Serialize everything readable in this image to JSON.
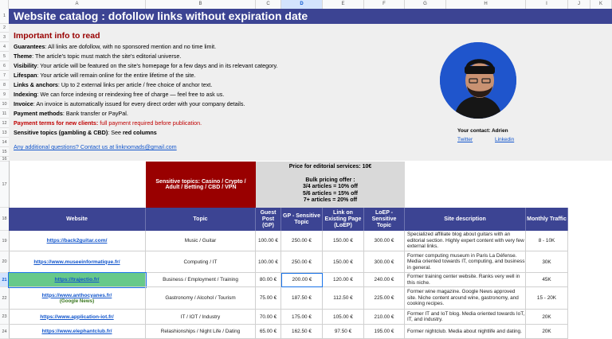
{
  "columns": [
    "A",
    "B",
    "C",
    "D",
    "E",
    "F",
    "G",
    "H",
    "I",
    "J",
    "K"
  ],
  "rows": [
    "1",
    "2",
    "3",
    "4",
    "5",
    "6",
    "7",
    "8",
    "9",
    "10",
    "11",
    "12",
    "13",
    "14",
    "15",
    "16",
    "17",
    "18",
    "19",
    "20",
    "21",
    "22",
    "23",
    "24"
  ],
  "title": "Website catalog : dofollow links without expiration date",
  "info": {
    "heading": "Important info to read",
    "lines": [
      {
        "label": "Guarantees",
        "text": ": All links are dofollow, with no sponsored mention and no time limit."
      },
      {
        "label": "Theme",
        "text": ": The article's topic must match the site's editorial universe."
      },
      {
        "label": "Visibility",
        "text": ": Your article will be featured on the site's homepage for a few days and in its relevant category."
      },
      {
        "label": "Lifespan",
        "text": ": Your article will remain online for the entire lifetime of the site."
      },
      {
        "label": "Links & anchors",
        "text": ": Up to 2 external links per article / free choice of anchor text."
      },
      {
        "label": "Indexing",
        "text": ": We can force indexing or reindexing free of charge — feel free to ask us."
      },
      {
        "label": "Invoice",
        "text": ": An invoice is automatically issued for every direct order with your company details."
      },
      {
        "label": "Payment methods",
        "text": ": Bank transfer or PayPal."
      }
    ],
    "payment_terms_label": "Payment terms for new clients:",
    "payment_terms_text": " full payment required before publication.",
    "sensitive_label": "Sensitive topics (gambling & CBD)",
    "sensitive_text": ": See ",
    "sensitive_bold": "red columns",
    "question_label": "Any additional questions?",
    "question_text": " Contact us at  linknomads@gmail.com"
  },
  "contact": {
    "label": "Your contact: Adrien",
    "twitter": "Twitter",
    "linkedin": "Linkedin"
  },
  "pricing": {
    "sensitive_header": "Sensitive topics: Casino / Crypto / Adult / Betting / CBD / VPN",
    "price_line": "Price for editorial services: 10€",
    "bulk_title": "Bulk pricing offer :",
    "bulk_1": "3/4 articles = 10% off",
    "bulk_2": "5/6 articles = 15% off",
    "bulk_3": "7+ articles = 20% off"
  },
  "headers": {
    "website": "Website",
    "topic": "Topic",
    "gp": "Guest Post (GP)",
    "gps": "GP - Sensitive Topic",
    "loep": "Link on Existing Page (LoEP)",
    "loeps": "LoEP - Sensitive Topic",
    "desc": "Site description",
    "traffic": "Monthly Traffic"
  },
  "table": [
    {
      "site": "https://back2guitar.com/",
      "tag": "",
      "topic": "Music / Guitar",
      "gp": "100.00 €",
      "gps": "250.00 €",
      "loep": "150.00 €",
      "loeps": "300.00 €",
      "desc": "Specialized affiliate blog about guitars with an editorial section. Highly expert content with very few external links.",
      "traffic": "8 - 10K"
    },
    {
      "site": "https://www.museeinformatique.fr/",
      "tag": "",
      "topic": "Computing / IT",
      "gp": "100.00 €",
      "gps": "250.00 €",
      "loep": "150.00 €",
      "loeps": "300.00 €",
      "desc": "Former computing museum in Paris La Défense. Media oriented towards IT, computing, and business in general.",
      "traffic": "30K"
    },
    {
      "site": "https://trajectio.fr/",
      "tag": "",
      "topic": "Business / Employment / Training",
      "gp": "80.00 €",
      "gps": "200.00 €",
      "loep": "120.00 €",
      "loeps": "240.00 €",
      "desc": "Former training center website. Ranks very well in this niche.",
      "traffic": "45K"
    },
    {
      "site": "https://www.anthocyanes.fr/",
      "tag": "(Google News)",
      "topic": "Gastronomy / Alcohol / Tourism",
      "gp": "75.00 €",
      "gps": "187.50 €",
      "loep": "112.50 €",
      "loeps": "225.00 €",
      "desc": "Former wine magazine. Google News approved site. Niche content around wine, gastronomy, and cooking recipes.",
      "traffic": "15 - 20K"
    },
    {
      "site": "https://www.application-iot.fr/",
      "tag": "",
      "topic": "IT / IOT / Industry",
      "gp": "70.00 €",
      "gps": "175.00 €",
      "loep": "105.00 €",
      "loeps": "210.00 €",
      "desc": "Former IT and IoT blog. Media oriented towards IoT, IT, and industry.",
      "traffic": "20K"
    },
    {
      "site": "https://www.elephantclub.fr/",
      "tag": "",
      "topic": "Relashionships / Night Life / Dating",
      "gp": "65.00 €",
      "gps": "162.50 €",
      "loep": "97.50 €",
      "loeps": "195.00 €",
      "desc": "Former nightclub. Media about nightlife and dating.",
      "traffic": "20K"
    }
  ]
}
